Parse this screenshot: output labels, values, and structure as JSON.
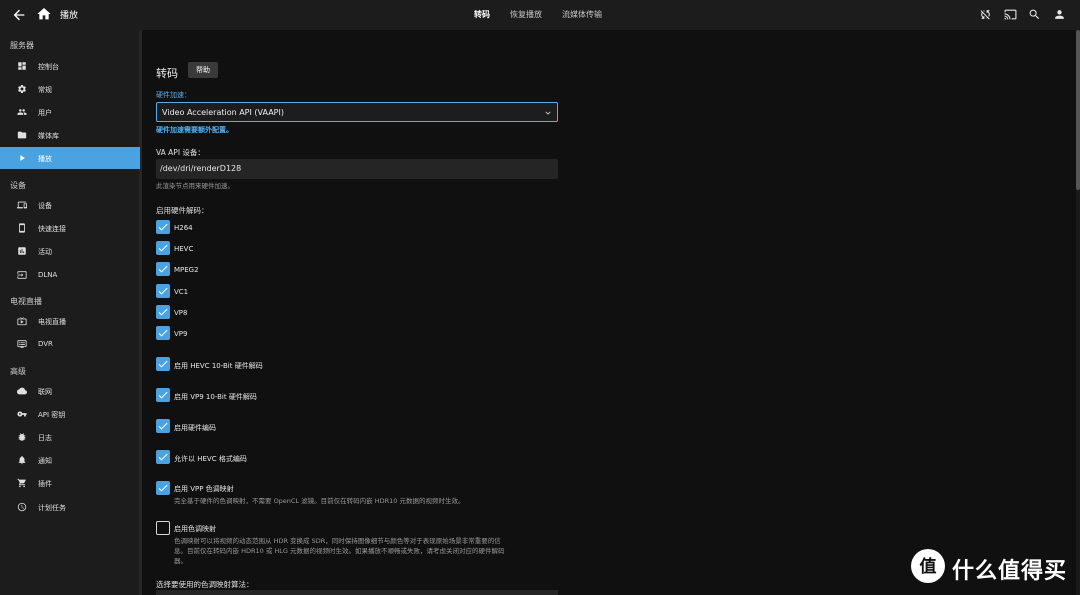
{
  "topbar": {
    "title": "播放",
    "tabs": [
      {
        "label": "转码",
        "active": true
      },
      {
        "label": "恢复播放",
        "active": false
      },
      {
        "label": "流媒体传输",
        "active": false
      }
    ],
    "right_icons": [
      "sync-disabled-icon",
      "cast-icon",
      "search-icon",
      "user-icon"
    ]
  },
  "sidebar": {
    "sections": [
      {
        "label": "服务器",
        "items": [
          {
            "label": "控制台",
            "icon": "dashboard-icon"
          },
          {
            "label": "常规",
            "icon": "gear-icon"
          },
          {
            "label": "用户",
            "icon": "people-icon"
          },
          {
            "label": "媒体库",
            "icon": "folder-icon"
          },
          {
            "label": "播放",
            "icon": "play-icon",
            "active": true
          }
        ]
      },
      {
        "label": "设备",
        "items": [
          {
            "label": "设备",
            "icon": "devices-icon"
          },
          {
            "label": "快速连接",
            "icon": "phone-icon"
          },
          {
            "label": "活动",
            "icon": "chart-icon"
          },
          {
            "label": "DLNA",
            "icon": "input-icon"
          }
        ]
      },
      {
        "label": "电视直播",
        "items": [
          {
            "label": "电视直播",
            "icon": "live-tv-icon"
          },
          {
            "label": "DVR",
            "icon": "dvr-icon"
          }
        ]
      },
      {
        "label": "高级",
        "items": [
          {
            "label": "联网",
            "icon": "cloud-icon"
          },
          {
            "label": "API 密钥",
            "icon": "key-icon"
          },
          {
            "label": "日志",
            "icon": "bug-icon"
          },
          {
            "label": "通知",
            "icon": "bell-icon"
          },
          {
            "label": "插件",
            "icon": "cart-icon"
          },
          {
            "label": "计划任务",
            "icon": "clock-icon"
          }
        ]
      }
    ]
  },
  "main": {
    "heading": "转码",
    "help_label": "帮助",
    "hw_accel_label": "硬件加速：",
    "hw_accel_value": "Video Acceleration API (VAAPI)",
    "hw_accel_link": "硬件加速需要额外配置。",
    "va_device_label": "VA API 设备：",
    "va_device_value": "/dev/dri/renderD128",
    "va_device_hint": "此渲染节点用来硬件加速。",
    "hw_decode_label": "启用硬件解码：",
    "codecs": [
      {
        "label": "H264",
        "checked": true
      },
      {
        "label": "HEVC",
        "checked": true
      },
      {
        "label": "MPEG2",
        "checked": true
      },
      {
        "label": "VC1",
        "checked": true
      },
      {
        "label": "VP8",
        "checked": true
      },
      {
        "label": "VP9",
        "checked": true
      }
    ],
    "options": [
      {
        "label": "启用 HEVC 10-Bit 硬件解码",
        "checked": true
      },
      {
        "label": "启用 VP9 10-Bit 硬件解码",
        "checked": true
      },
      {
        "label": "启用硬件编码",
        "checked": true
      },
      {
        "label": "允许以 HEVC 格式编码",
        "checked": true
      },
      {
        "label": "启用 VPP 色调映射",
        "checked": true,
        "hint": "完全基于硬件的色调映射，不需要 OpenCL 滤镜。目前仅在转码内嵌 HDR10 元数据的视频时生效。"
      },
      {
        "label": "启用色调映射",
        "checked": false,
        "hint_lines": [
          "色调映射可以将视频的动态范围从 HDR 变换成 SDR，同时保持图像细节与颜色等对于表现原始场景非常重要的信",
          "息。目前仅在转码内嵌 HDR10 或 HLG 元数据的视频时生效。如果播放不顺畅或失败，请考虑关闭对应的硬件解码",
          "器。"
        ]
      }
    ],
    "tonemap_algo_label": "选择要使用的色调映射算法："
  },
  "watermark": {
    "text": "什么值得买"
  }
}
